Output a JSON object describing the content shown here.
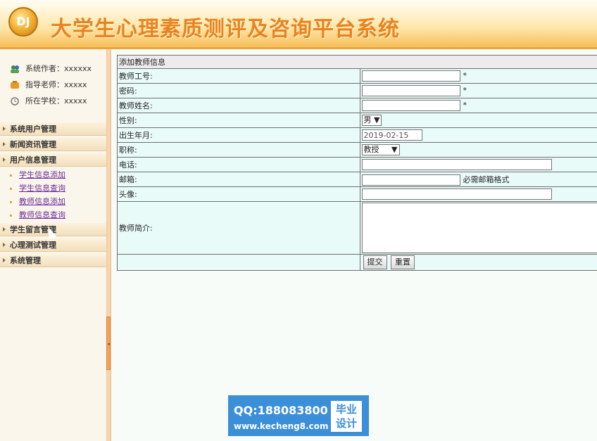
{
  "header": {
    "logo_text": "DJ",
    "title": "大学生心理素质测评及咨询平台系统"
  },
  "sidebar": {
    "info": [
      {
        "label": "系统作者：",
        "value": "xxxxxx",
        "icon": "users-icon"
      },
      {
        "label": "指导老师：",
        "value": "xxxxx",
        "icon": "teacher-icon"
      },
      {
        "label": "所在学校：",
        "value": "xxxxx",
        "icon": "school-icon"
      }
    ],
    "menus": [
      {
        "label": "系统用户管理"
      },
      {
        "label": "新闻资讯管理"
      },
      {
        "label": "用户信息管理"
      },
      {
        "label": "学生留言管理"
      },
      {
        "label": "心理测试管理"
      },
      {
        "label": "系统管理"
      }
    ],
    "subitems": [
      {
        "label": "学生信息添加"
      },
      {
        "label": "学生信息查询"
      },
      {
        "label": "教师信息添加"
      },
      {
        "label": "教师信息查询"
      }
    ]
  },
  "form": {
    "title": "添加教师信息",
    "fields": {
      "teacher_id": {
        "label": "教师工号:",
        "value": "",
        "required": "*"
      },
      "password": {
        "label": "密码:",
        "value": "",
        "required": "*"
      },
      "name": {
        "label": "教师姓名:",
        "value": "",
        "required": "*"
      },
      "gender": {
        "label": "性别:",
        "value": "男"
      },
      "birthdate": {
        "label": "出生年月:",
        "value": "2019-02-15"
      },
      "title": {
        "label": "职称:",
        "value": "教授"
      },
      "phone": {
        "label": "电话:",
        "value": ""
      },
      "email": {
        "label": "邮箱:",
        "value": "",
        "hint": "必需邮箱格式"
      },
      "avatar": {
        "label": "头像:",
        "value": ""
      },
      "intro": {
        "label": "教师简介:",
        "value": ""
      }
    },
    "submit_label": "提交",
    "reset_label": "重置"
  },
  "watermark": {
    "qq": "QQ:188083800",
    "url": "www.kecheng8.com",
    "badge_line1": "毕业",
    "badge_line2": "设计"
  },
  "colors": {
    "title_orange": "#e9831e",
    "table_bg": "#e8fbf8",
    "watermark_blue": "#3b8ed8"
  }
}
